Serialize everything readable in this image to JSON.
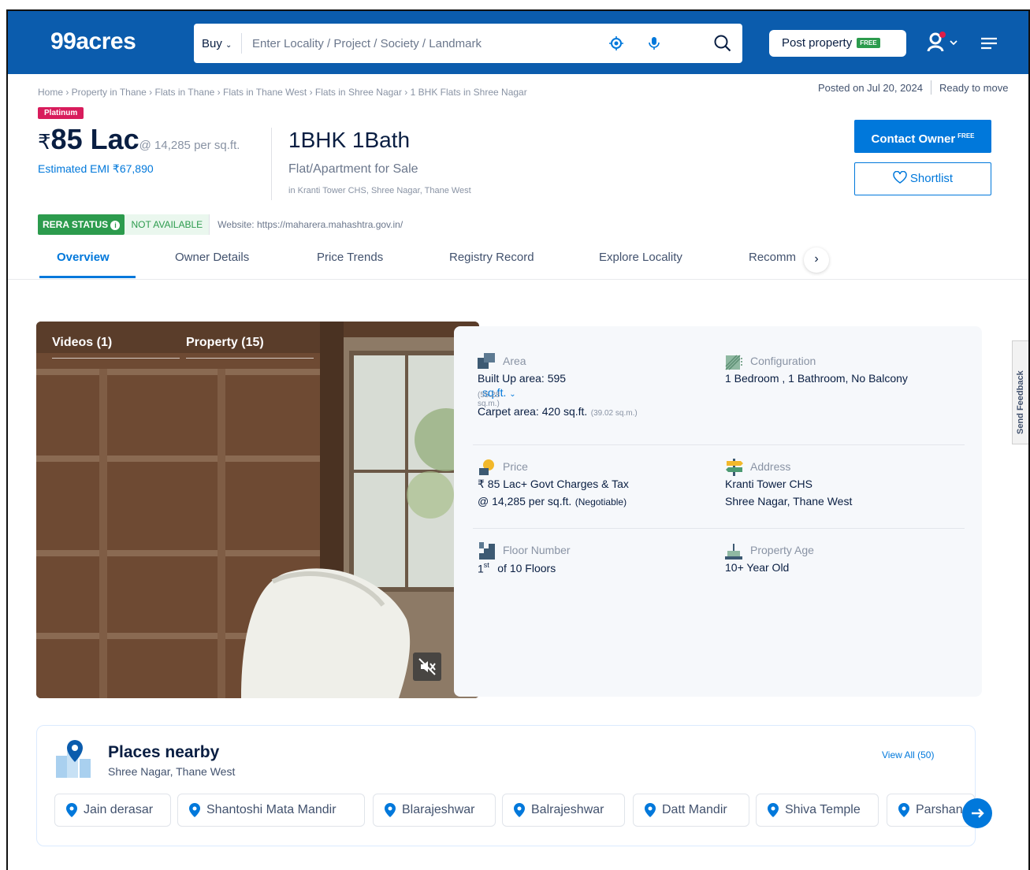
{
  "header": {
    "logo": "99acres",
    "search": {
      "mode": "Buy",
      "placeholder": "Enter Locality / Project / Society / Landmark"
    },
    "post_property": "Post property",
    "free_tag": "FREE"
  },
  "breadcrumb": "Home › Property in Thane › Flats in Thane › Flats in Thane West › Flats in Shree Nagar › 1 BHK Flats in Shree Nagar",
  "posted": "Posted on Jul 20, 2024",
  "status": "Ready to move",
  "badge": "Platinum",
  "price": {
    "currency": "₹",
    "amount": "85 Lac",
    "per_sqft": "@ 14,285 per sq.ft.",
    "emi": "Estimated EMI ₹67,890"
  },
  "title": "1BHK 1Bath",
  "property_type": "Flat/Apartment for Sale",
  "location": "in Kranti Tower CHS, Shree Nagar, Thane West",
  "actions": {
    "contact": "Contact Owner",
    "contact_tag": "FREE",
    "shortlist": "Shortlist"
  },
  "rera": {
    "label": "RERA STATUS",
    "status": "NOT AVAILABLE",
    "website": "Website: https://maharera.mahashtra.gov.in/"
  },
  "tabs": [
    "Overview",
    "Owner Details",
    "Price Trends",
    "Registry Record",
    "Explore Locality",
    "Recomm"
  ],
  "media": {
    "videos": "Videos (1)",
    "property": "Property (15)"
  },
  "details": {
    "area": {
      "label": "Area",
      "built_up": "Built Up area: 595",
      "unit": "sq.ft.",
      "built_up_sqm": "(55.28 sq.m.)",
      "carpet": "Carpet area: 420 sq.ft.",
      "carpet_sqm": "(39.02 sq.m.)"
    },
    "configuration": {
      "label": "Configuration",
      "value": "1 Bedroom , 1 Bathroom, No Balcony"
    },
    "price": {
      "label": "Price",
      "line1": "₹ 85 Lac+ Govt Charges & Tax",
      "line2": "@ 14,285 per sq.ft.",
      "negotiable": "(Negotiable)"
    },
    "address": {
      "label": "Address",
      "line1": "Kranti Tower CHS",
      "line2": "Shree Nagar, Thane West"
    },
    "floor": {
      "label": "Floor Number",
      "floor": "1",
      "suffix": "st",
      "total": "of 10 Floors"
    },
    "age": {
      "label": "Property Age",
      "value": "10+ Year Old"
    }
  },
  "feedback": "Send Feedback",
  "nearby": {
    "title": "Places nearby",
    "subtitle": "Shree Nagar, Thane West",
    "view_all": "View All (50)",
    "places": [
      "Jain derasar",
      "Shantoshi Mata Mandir",
      "Blarajeshwar",
      "Balrajeshwar",
      "Datt Mandir",
      "Shiva Temple",
      "Parshanath"
    ]
  },
  "colors": {
    "brand": "#0B5CAD",
    "accent": "#0078DB",
    "platinum": "#D81C5C",
    "green": "#2C9B4D"
  }
}
